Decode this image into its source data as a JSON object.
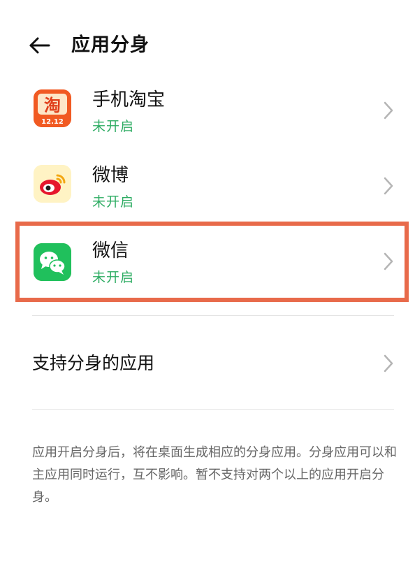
{
  "header": {
    "title": "应用分身",
    "back_icon": "arrow-left-icon"
  },
  "apps": [
    {
      "name": "手机淘宝",
      "status": "未开启",
      "icon": "taobao-app-icon",
      "icon_char": "淘",
      "icon_badge": "12.12"
    },
    {
      "name": "微博",
      "status": "未开启",
      "icon": "weibo-app-icon"
    },
    {
      "name": "微信",
      "status": "未开启",
      "icon": "wechat-app-icon"
    }
  ],
  "supported": {
    "label": "支持分身的应用"
  },
  "description": "应用开启分身后，将在桌面生成相应的分身应用。分身应用可以和主应用同时运行，互不影响。暂不支持对两个以上的应用开启分身。",
  "colors": {
    "status_green": "#2eac63",
    "highlight": "#e86a4a",
    "taobao_orange": "#f15a22",
    "weibo_bg": "#fff3c4",
    "wechat_green": "#1aad19"
  }
}
